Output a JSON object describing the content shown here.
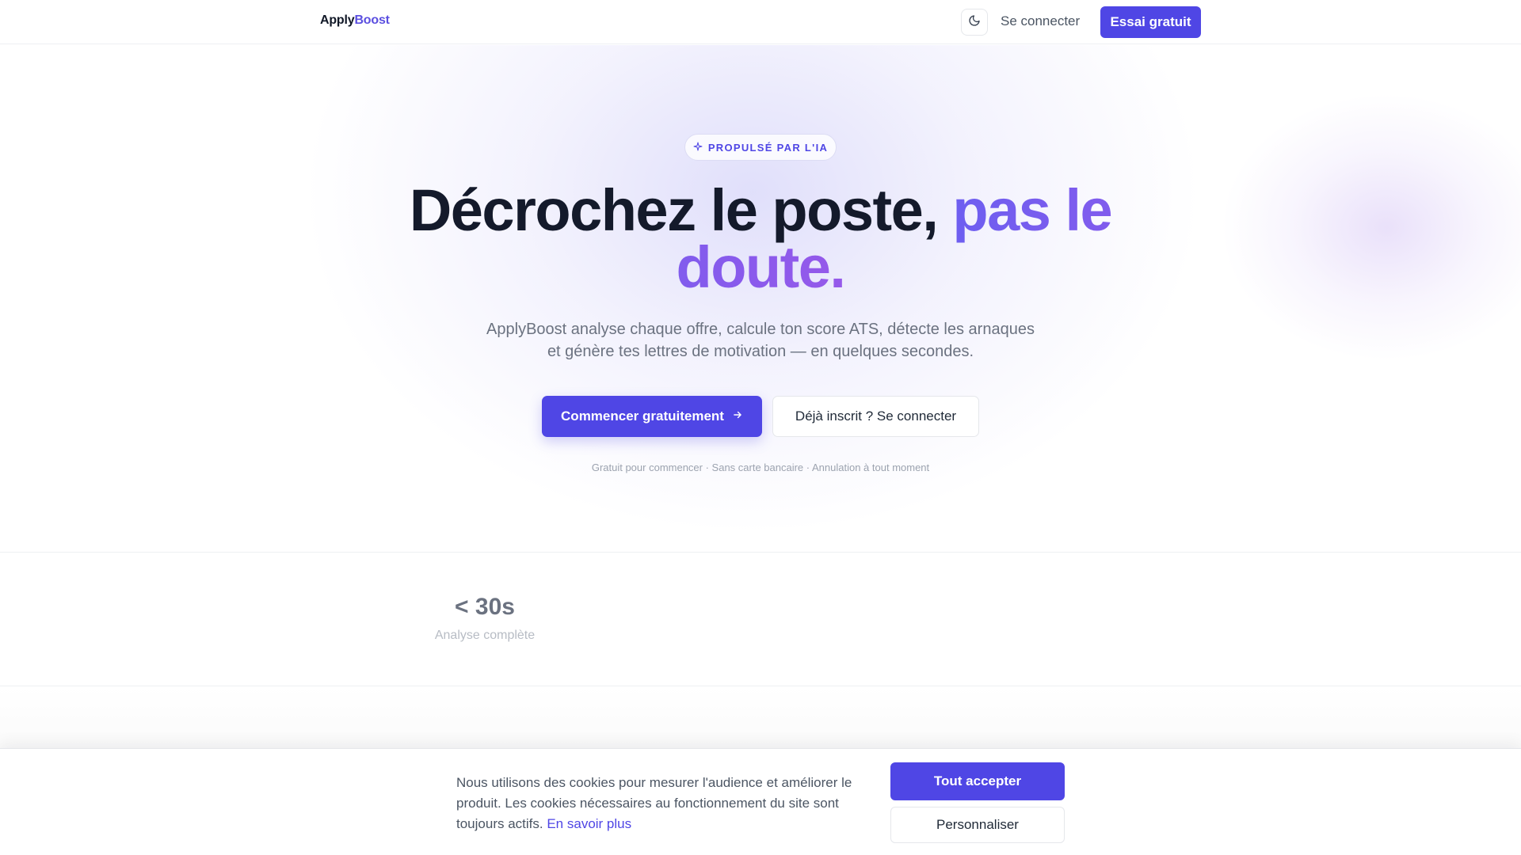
{
  "header": {
    "logo_part1": "Apply",
    "logo_part2": "Boost",
    "theme_toggle_icon": "moon-icon",
    "signin_label": "Se connecter",
    "trial_label": "Essai gratuit"
  },
  "hero": {
    "badge_icon": "sparkle-icon",
    "badge_label": "PROPULSÉ PAR L'IA",
    "headline_main": "Décrochez le poste, ",
    "headline_accent": "pas le doute.",
    "subtitle": "ApplyBoost analyse chaque offre, calcule ton score ATS, détecte les arnaques et génère tes lettres de motivation — en quelques secondes.",
    "cta_primary_label": "Commencer gratuitement",
    "cta_primary_icon": "arrow-right-icon",
    "cta_secondary_label": "Déjà inscrit ? Se connecter",
    "fineprint": "Gratuit pour commencer · Sans carte bancaire · Annulation à tout moment"
  },
  "stats": [
    {
      "value": "< 30s",
      "label": "Analyse complète"
    }
  ],
  "cookie": {
    "text": "Nous utilisons des cookies pour mesurer l'audience et améliorer le produit. Les cookies nécessaires au fonctionnement du site sont toujours actifs.",
    "link_label": "En savoir plus",
    "accept_label": "Tout accepter",
    "customize_label": "Personnaliser"
  },
  "colors": {
    "accent": "#4f46e5",
    "headline": "#141a2b",
    "gradient_start": "#6d5ef0",
    "gradient_end": "#9659ea"
  }
}
